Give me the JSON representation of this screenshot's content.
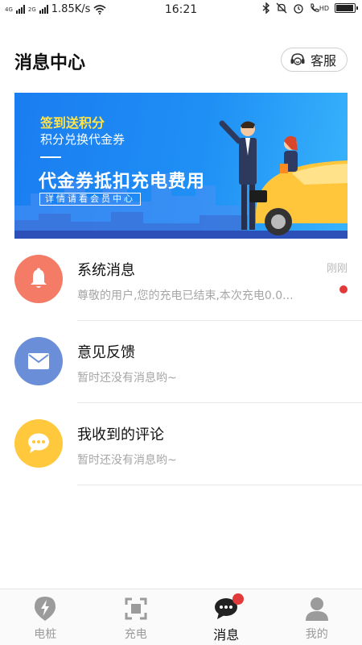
{
  "status_bar": {
    "network_label": "4G",
    "network_label_2": "2G",
    "speed": "1.85K/s",
    "time": "16:21",
    "hd_label": "HD",
    "battery_level": 0.95
  },
  "header": {
    "title": "消息中心",
    "service_label": "客服"
  },
  "banner": {
    "promo": "签到送积分",
    "exchange": "积分兑换代金券",
    "headline": "代金券抵扣充电费用",
    "subline": "详情请看会员中心"
  },
  "messages": [
    {
      "title": "系统消息",
      "preview": "尊敬的用户,您的充电已结束,本次充电0.0...",
      "time": "刚刚",
      "unread": true,
      "icon": "bell-icon",
      "color": "#f47c66"
    },
    {
      "title": "意见反馈",
      "preview": "暂时还没有消息哟~",
      "icon": "envelope-icon",
      "color": "#6a8fd8"
    },
    {
      "title": "我收到的评论",
      "preview": "暂时还没有消息哟~",
      "icon": "chat-bubble-icon",
      "color": "#ffc83d"
    }
  ],
  "tabbar": {
    "tabs": [
      {
        "label": "电桩",
        "icon": "lightning-pin-icon"
      },
      {
        "label": "充电",
        "icon": "scan-icon"
      },
      {
        "label": "消息",
        "icon": "message-icon",
        "active": true,
        "badge": true
      },
      {
        "label": "我的",
        "icon": "user-icon"
      }
    ]
  }
}
